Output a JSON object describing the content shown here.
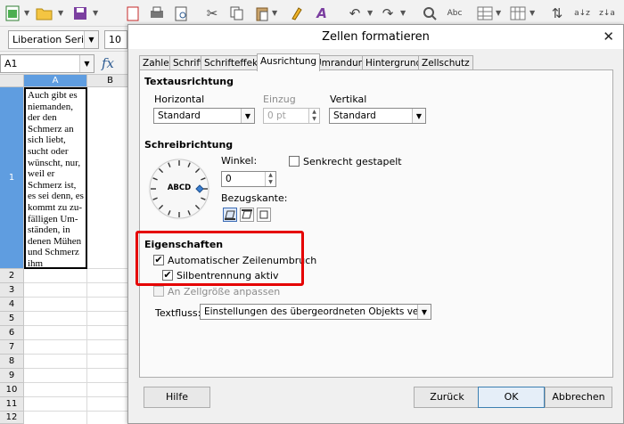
{
  "font": {
    "name": "Liberation Serif",
    "size": "10"
  },
  "cell_ref": "A1",
  "fx_symbol": "fx",
  "columns": [
    "A",
    "B"
  ],
  "rows": [
    "1",
    "2",
    "3",
    "4",
    "5",
    "6",
    "7",
    "8",
    "9",
    "10",
    "11",
    "12"
  ],
  "cell_text": [
    "Auch gibt es",
    "niemanden,",
    "der den",
    "Schmerz an",
    "sich liebt,",
    "sucht oder",
    "wünscht, nur,",
    "weil er",
    "Schmerz ist,",
    "es sei denn, es",
    "kommt zu zu-",
    "fälligen Um-",
    "ständen, in",
    "denen Mühen",
    "und Schmerz",
    "ihm"
  ],
  "dialog": {
    "title": "Zellen formatieren",
    "close": "✕",
    "tabs": [
      "Zahlen",
      "Schrift",
      "Schrifteffekte",
      "Ausrichtung",
      "Umrandung",
      "Hintergrund",
      "Zellschutz"
    ],
    "text_alignment": {
      "title": "Textausrichtung",
      "horizontal_label": "Horizontal",
      "horizontal_value": "Standard",
      "indent_label": "Einzug",
      "indent_value": "0 pt",
      "vertical_label": "Vertikal",
      "vertical_value": "Standard"
    },
    "writing_direction": {
      "title": "Schreibrichtung",
      "dial_text": "ABCD",
      "angle_label": "Winkel:",
      "angle_value": "0",
      "edge_label": "Bezugskante:",
      "stacked_label": "Senkrecht gestapelt"
    },
    "properties": {
      "title": "Eigenschaften",
      "auto_wrap_label": "Automatischer Zeilenumbruch",
      "hyphenation_label": "Silbentrennung aktiv",
      "shrink_label": "An Zellgröße anpassen"
    },
    "textflow": {
      "label": "Textfluss:",
      "value": "Einstellungen des übergeordneten Objekts verwenden"
    },
    "buttons": {
      "help": "Hilfe",
      "reset": "Zurück",
      "ok": "OK",
      "cancel": "Abbrechen"
    }
  },
  "colors": {
    "highlight": "#e50000",
    "selection": "#4a90d9"
  }
}
